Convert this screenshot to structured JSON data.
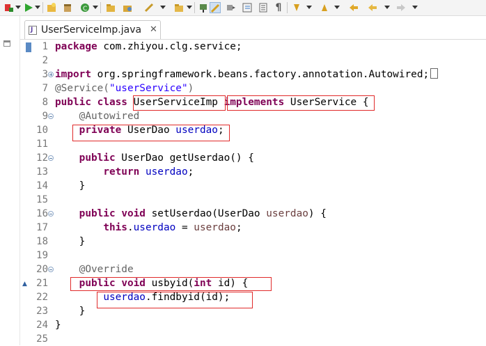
{
  "tab": {
    "label": "UserServiceImp.java",
    "close": "✕"
  },
  "colors": {
    "keyword": "#7f0055",
    "string": "#2a00ff",
    "field": "#0000c0",
    "annotation": "#646464",
    "highlight_box": "#e02a2a"
  },
  "editor": {
    "lines": [
      {
        "num": "1",
        "parts": [
          [
            "kw",
            "package"
          ],
          [
            "t",
            " com.zhiyou.clg.service;"
          ]
        ]
      },
      {
        "num": "2",
        "parts": []
      },
      {
        "num": "3",
        "fold": "plus",
        "parts": [
          [
            "kw",
            "import"
          ],
          [
            "t",
            " org.springframework.beans.factory.annotation.Autowired;"
          ]
        ]
      },
      {
        "num": "7",
        "parts": [
          [
            "ann",
            "@Service("
          ],
          [
            "str",
            "\"userService\""
          ],
          [
            "ann",
            ")"
          ]
        ]
      },
      {
        "num": "8",
        "parts": [
          [
            "kw",
            "public"
          ],
          [
            "t",
            " "
          ],
          [
            "kw",
            "class"
          ],
          [
            "t",
            " UserServiceImp "
          ],
          [
            "kw",
            "implements"
          ],
          [
            "t",
            " UserService {"
          ]
        ]
      },
      {
        "num": "9",
        "fold": "minus",
        "parts": [
          [
            "t",
            "    "
          ],
          [
            "ann",
            "@Autowired"
          ]
        ]
      },
      {
        "num": "10",
        "parts": [
          [
            "t",
            "    "
          ],
          [
            "kw",
            "private"
          ],
          [
            "t",
            " UserDao "
          ],
          [
            "fld",
            "userdao"
          ],
          [
            "t",
            ";"
          ]
        ]
      },
      {
        "num": "11",
        "parts": []
      },
      {
        "num": "12",
        "fold": "minus",
        "parts": [
          [
            "t",
            "    "
          ],
          [
            "kw",
            "public"
          ],
          [
            "t",
            " UserDao getUserdao() {"
          ]
        ]
      },
      {
        "num": "13",
        "parts": [
          [
            "t",
            "        "
          ],
          [
            "kw",
            "return"
          ],
          [
            "t",
            " "
          ],
          [
            "fld",
            "userdao"
          ],
          [
            "t",
            ";"
          ]
        ]
      },
      {
        "num": "14",
        "parts": [
          [
            "t",
            "    }"
          ]
        ]
      },
      {
        "num": "15",
        "parts": []
      },
      {
        "num": "16",
        "fold": "minus",
        "parts": [
          [
            "t",
            "    "
          ],
          [
            "kw",
            "public"
          ],
          [
            "t",
            " "
          ],
          [
            "kw",
            "void"
          ],
          [
            "t",
            " setUserdao(UserDao "
          ],
          [
            "param",
            "userdao"
          ],
          [
            "t",
            ") {"
          ]
        ]
      },
      {
        "num": "17",
        "parts": [
          [
            "t",
            "        "
          ],
          [
            "kw",
            "this"
          ],
          [
            "t",
            "."
          ],
          [
            "fld",
            "userdao"
          ],
          [
            "t",
            " = "
          ],
          [
            "param",
            "userdao"
          ],
          [
            "t",
            ";"
          ]
        ]
      },
      {
        "num": "18",
        "parts": [
          [
            "t",
            "    }"
          ]
        ]
      },
      {
        "num": "19",
        "parts": []
      },
      {
        "num": "20",
        "fold": "minus",
        "parts": [
          [
            "t",
            "    "
          ],
          [
            "ann",
            "@Override"
          ]
        ]
      },
      {
        "num": "21",
        "parts": [
          [
            "t",
            "    "
          ],
          [
            "kw",
            "public"
          ],
          [
            "t",
            " "
          ],
          [
            "kw",
            "void"
          ],
          [
            "t",
            " usbyid("
          ],
          [
            "kw",
            "int"
          ],
          [
            "t",
            " id) {"
          ]
        ]
      },
      {
        "num": "22",
        "parts": [
          [
            "t",
            "        "
          ],
          [
            "fld",
            "userdao"
          ],
          [
            "t",
            ".findbyid(id);"
          ]
        ]
      },
      {
        "num": "23",
        "parts": [
          [
            "t",
            "    }"
          ]
        ]
      },
      {
        "num": "24",
        "parts": [
          [
            "t",
            "}"
          ]
        ]
      },
      {
        "num": "25",
        "parts": []
      }
    ]
  }
}
